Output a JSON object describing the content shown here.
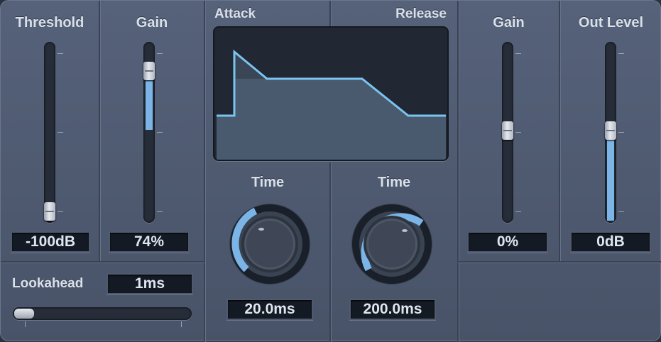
{
  "compressor": {
    "threshold": {
      "label": "Threshold",
      "value": "-100dB",
      "level": 0.0
    },
    "gain": {
      "label": "Gain",
      "value": "74%",
      "level": 0.74
    }
  },
  "lookahead": {
    "label": "Lookahead",
    "value": "1ms"
  },
  "envelope": {
    "attack_label": "Attack",
    "release_label": "Release",
    "attack_time": {
      "label": "Time",
      "value": "20.0ms"
    },
    "release_time": {
      "label": "Time",
      "value": "200.0ms"
    }
  },
  "output": {
    "gain": {
      "label": "Gain",
      "value": "0%"
    },
    "out_level": {
      "label": "Out Level",
      "value": "0dB"
    }
  },
  "colors": {
    "accent": "#7bb4e6",
    "panel": "#505c72",
    "display": "#212834"
  }
}
